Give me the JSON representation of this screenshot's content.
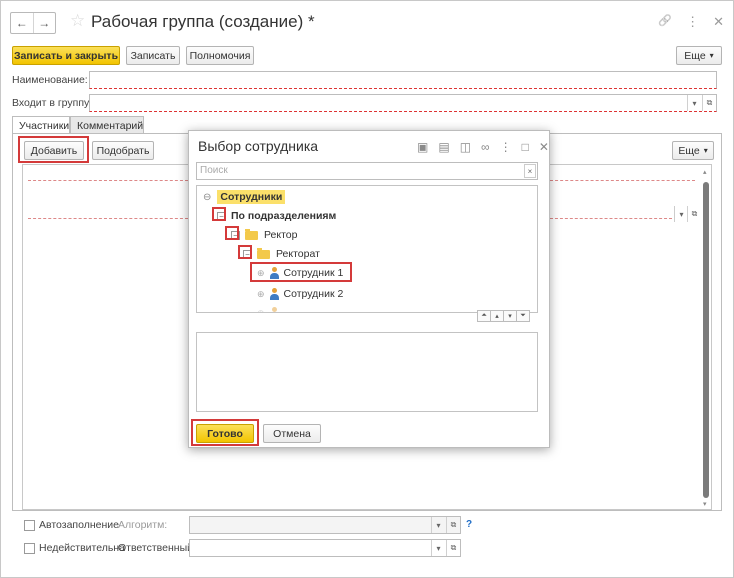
{
  "window": {
    "title": "Рабочая группа (создание) *",
    "back_glyph": "←",
    "forward_glyph": "→",
    "star_glyph": "☆",
    "link_glyph": "🔗",
    "menu_glyph": "⋮",
    "close_glyph": "✕"
  },
  "toolbar": {
    "save_close_label": "Записать и закрыть",
    "save_label": "Записать",
    "permissions_label": "Полномочия",
    "more_label": "Еще"
  },
  "form": {
    "name_label": "Наименование:",
    "group_label": "Входит в группу:"
  },
  "tabs": [
    {
      "label": "Участники"
    },
    {
      "label": "Комментарий"
    }
  ],
  "participants": {
    "add_label": "Добавить",
    "pick_label": "Подобрать",
    "more_label": "Еще"
  },
  "bottom": {
    "autofill_label": "Автозаполнение",
    "algorithm_label": "Алгоритм:",
    "invalid_label": "Недействительна",
    "responsible_label": "Ответственный:",
    "help_glyph": "?"
  },
  "dialog": {
    "title": "Выбор сотрудника",
    "search_placeholder": "Поиск",
    "tree": [
      {
        "label": "Сотрудники"
      },
      {
        "label": "По подразделениям"
      },
      {
        "label": "Ректор"
      },
      {
        "label": "Ректорат"
      },
      {
        "label": "Сотрудник 1"
      },
      {
        "label": "Сотрудник 2"
      }
    ],
    "ok_label": "Готово",
    "cancel_label": "Отмена"
  },
  "colors": {
    "accent_yellow": "#f2c400",
    "highlight_red": "#d43a3a"
  }
}
